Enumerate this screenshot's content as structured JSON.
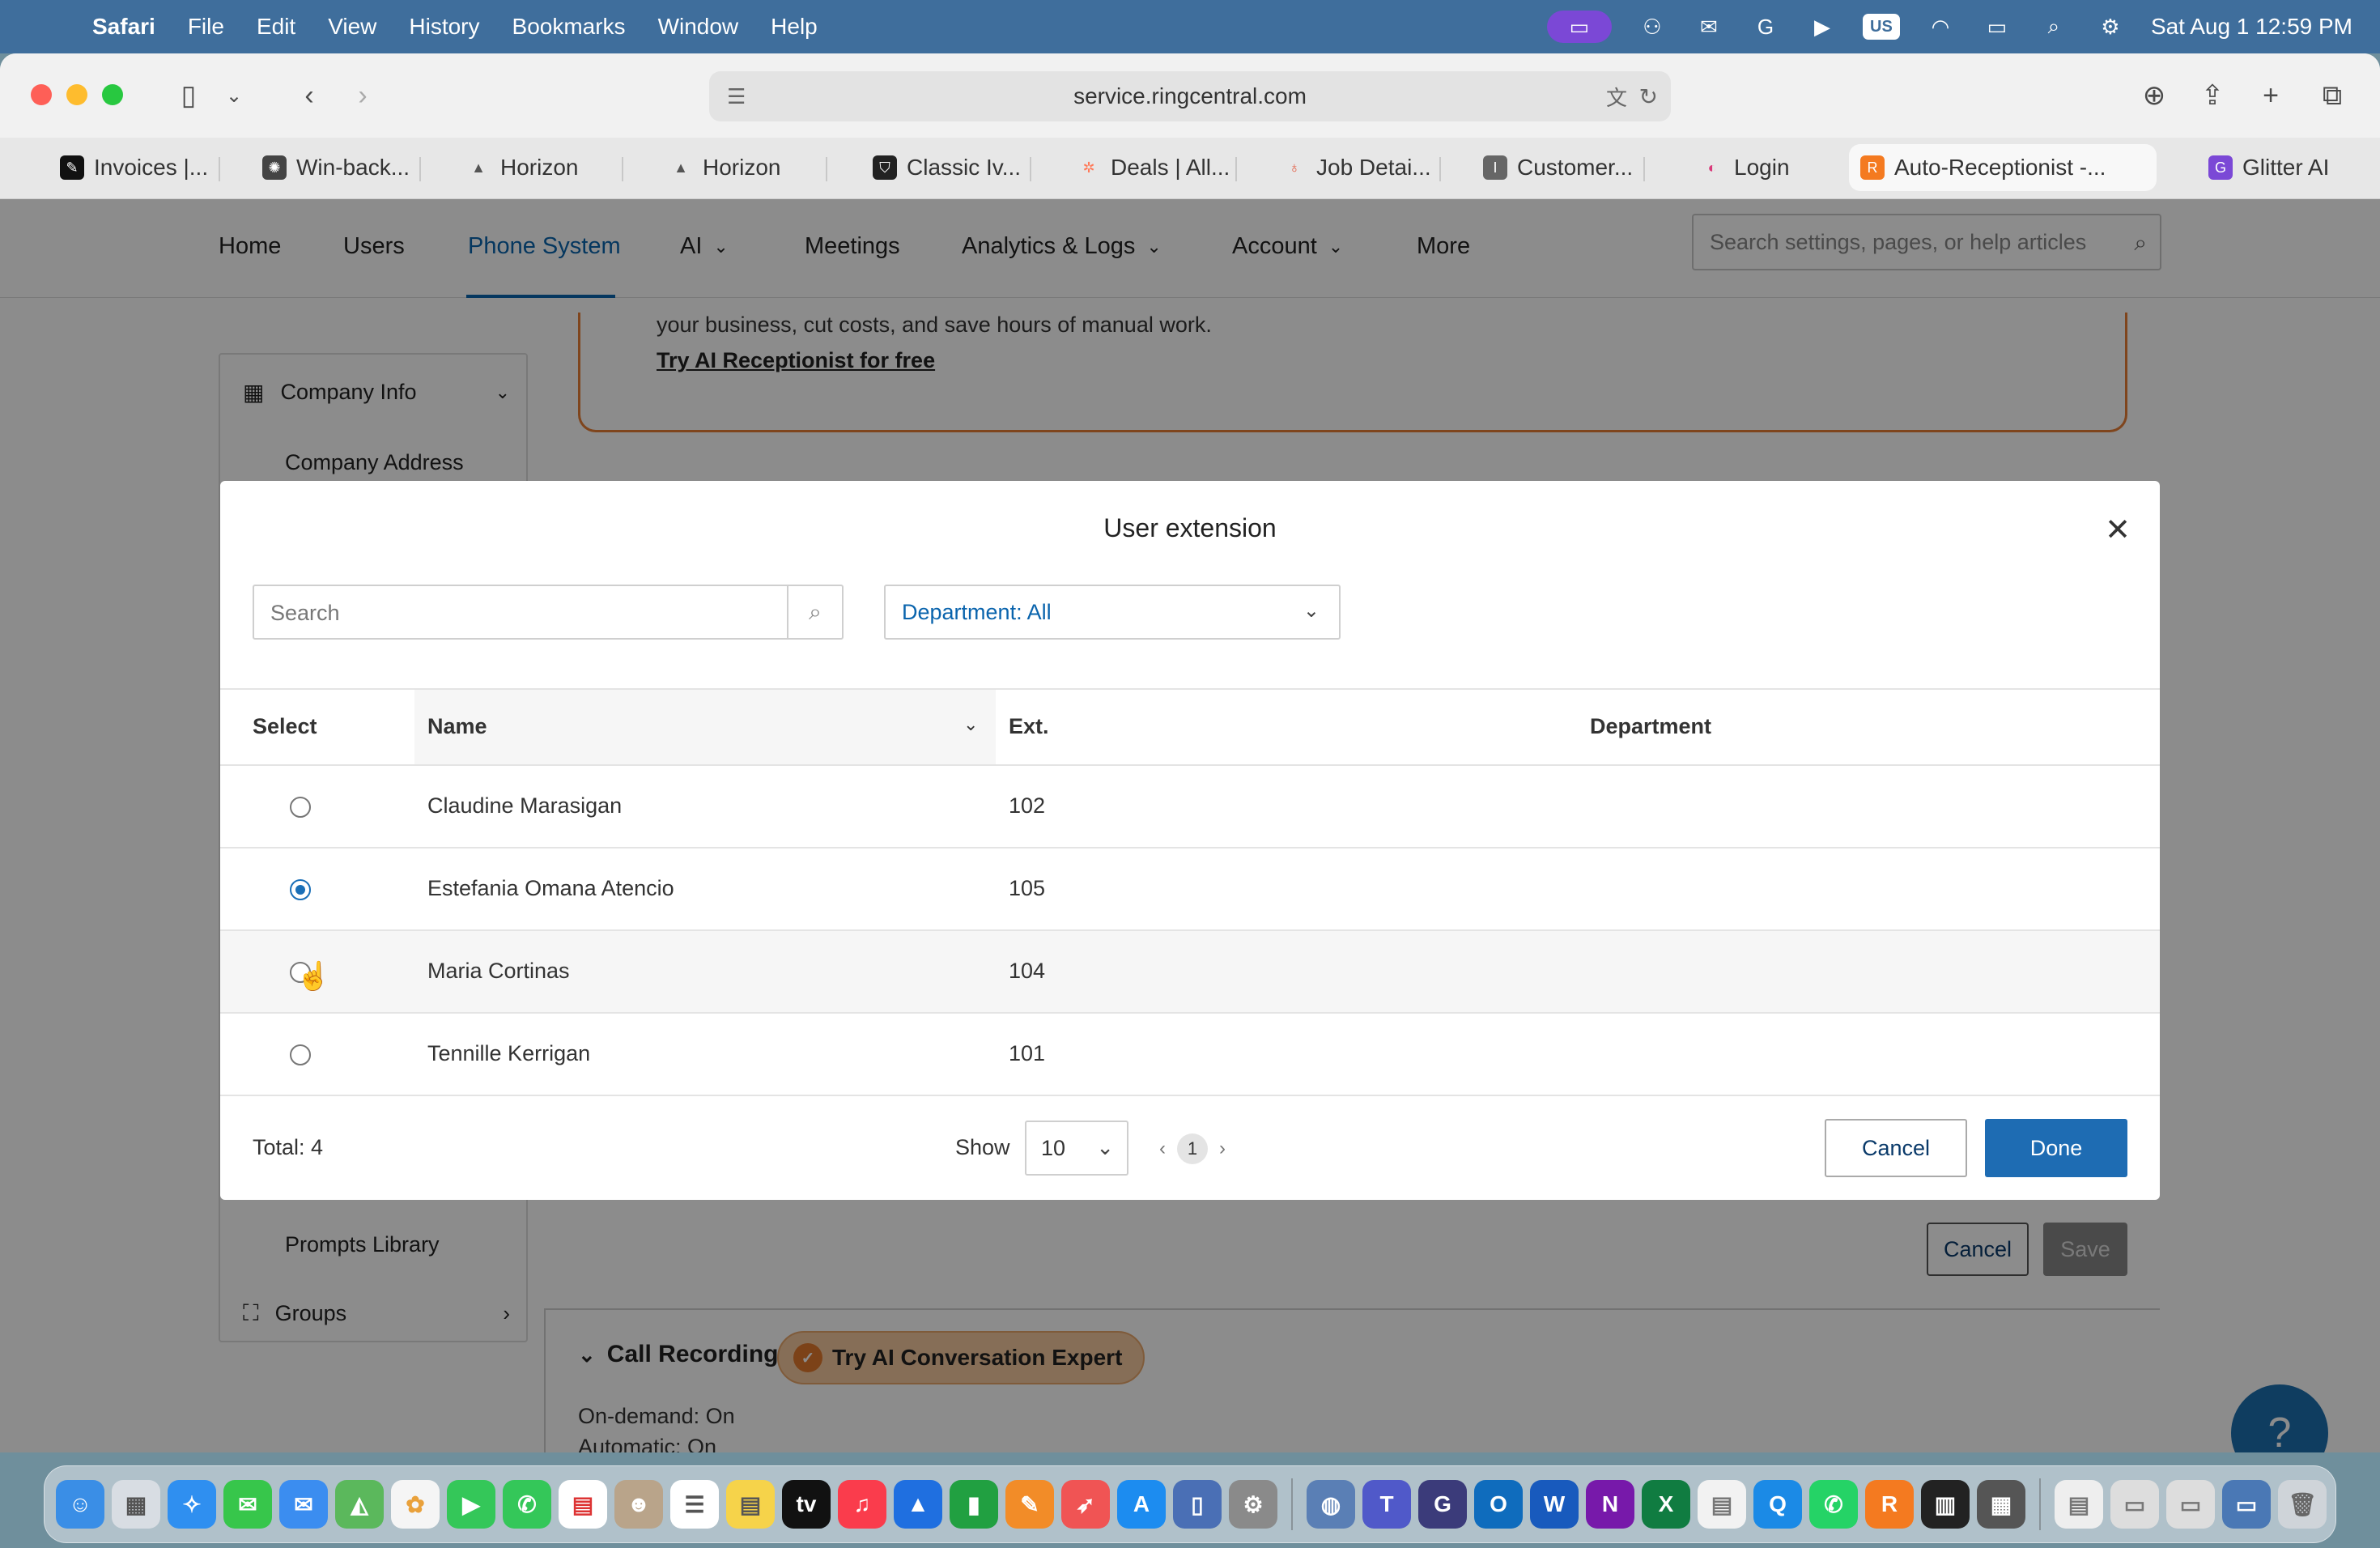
{
  "menubar": {
    "app": "Safari",
    "menus": [
      "File",
      "Edit",
      "View",
      "History",
      "Bookmarks",
      "Window",
      "Help"
    ],
    "input_source": "US",
    "clock": "Sat Aug 1  12:59 PM"
  },
  "browser": {
    "url": "service.ringcentral.com",
    "tabs": [
      {
        "label": "Invoices |...",
        "color": "#111111"
      },
      {
        "label": "Win-back...",
        "color": "#444444"
      },
      {
        "label": "Horizon",
        "color": "#555555"
      },
      {
        "label": "Horizon",
        "color": "#555555"
      },
      {
        "label": "Classic Iv...",
        "color": "#222222"
      },
      {
        "label": "Deals | All...",
        "color": "#ff7a59"
      },
      {
        "label": "Job Detai...",
        "color": "#e2553a"
      },
      {
        "label": "Customer...",
        "color": "#666666"
      },
      {
        "label": "Login",
        "color": "#d93a7a"
      },
      {
        "label": "Auto-Receptionist -...",
        "color": "#f47a20"
      },
      {
        "label": "Glitter AI",
        "color": "#7b48d6"
      }
    ]
  },
  "topnav": {
    "items": [
      "Home",
      "Users",
      "Phone System",
      "AI",
      "Meetings",
      "Analytics & Logs",
      "Account",
      "More"
    ],
    "active": "Phone System",
    "search_placeholder": "Search settings, pages, or help articles"
  },
  "sidebar": {
    "company_info": "Company Info",
    "company_address": "Company Address",
    "prompts_library": "Prompts Library",
    "groups": "Groups"
  },
  "promo": {
    "text": "your business, cut costs, and save hours of manual work.",
    "link": "Try AI Receptionist for free"
  },
  "background": {
    "cancel": "Cancel",
    "save": "Save",
    "call_recording": "Call Recording",
    "ai_badge": "Try AI Conversation Expert",
    "on_demand": "On-demand: On",
    "automatic": "Automatic: On"
  },
  "modal": {
    "title": "User extension",
    "search_placeholder": "Search",
    "department_filter": "Department: All",
    "columns": {
      "select": "Select",
      "name": "Name",
      "ext": "Ext.",
      "department": "Department"
    },
    "rows": [
      {
        "name": "Claudine Marasigan",
        "ext": "102",
        "department": "",
        "selected": false
      },
      {
        "name": "Estefania Omana Atencio",
        "ext": "105",
        "department": "",
        "selected": true
      },
      {
        "name": "Maria Cortinas",
        "ext": "104",
        "department": "",
        "selected": false
      },
      {
        "name": "Tennille Kerrigan",
        "ext": "101",
        "department": "",
        "selected": false
      }
    ],
    "total": "Total: 4",
    "show_label": "Show",
    "page_size": "10",
    "current_page": "1",
    "cancel": "Cancel",
    "done": "Done"
  }
}
